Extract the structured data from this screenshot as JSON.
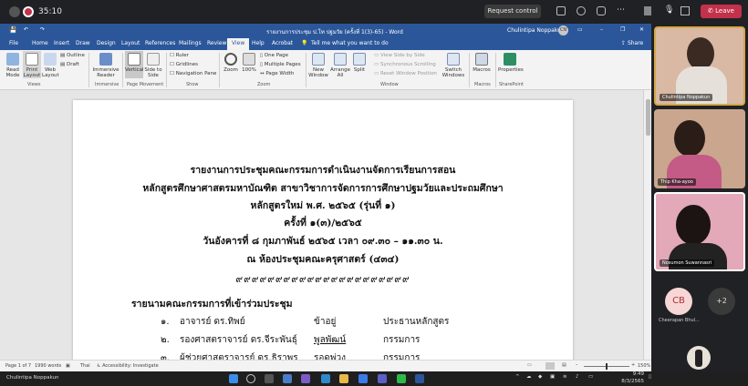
{
  "meeting": {
    "timer": "35:10",
    "request_control": "Request control",
    "leave": "Leave",
    "presenter_label": "Chulintipa Noppakun"
  },
  "word": {
    "title": "รายงานการประชุม ป.โท ปฐมวัย (ครั้งที่ 1(3)-65)  -  Word",
    "user": "Chulintipa Noppakun",
    "user_initials": "CN",
    "tell_me": "Tell me what you want to do",
    "share": "Share",
    "tabs": [
      "File",
      "Home",
      "Insert",
      "Draw",
      "Design",
      "Layout",
      "References",
      "Mailings",
      "Review",
      "View",
      "Help",
      "Acrobat"
    ],
    "active_tab": "View"
  },
  "ribbon": {
    "views": [
      "Read Mode",
      "Print Layout",
      "Web Layout"
    ],
    "immersive": "Immersive Reader",
    "page_movement": [
      "Vertical",
      "Side to Side"
    ],
    "show": [
      "Ruler",
      "Gridlines",
      "Navigation Pane"
    ],
    "outline": "Outline",
    "draft": "Draft",
    "zoom": [
      "Zoom",
      "100%"
    ],
    "zoom_opts": [
      "One Page",
      "Multiple Pages",
      "Page Width"
    ],
    "window": [
      "New Window",
      "Arrange All",
      "Split"
    ],
    "window_opts": [
      "View Side by Side",
      "Synchronous Scrolling",
      "Reset Window Position"
    ],
    "switch_windows": "Switch Windows",
    "macros": "Macros",
    "properties": "Properties",
    "groups": [
      "Views",
      "Immersive",
      "Page Movement",
      "Show",
      "Zoom",
      "Window",
      "Macros",
      "SharePoint"
    ]
  },
  "document": {
    "heading_lines": [
      "รายงานการประชุมคณะกรรมการดำเนินงานจัดการเรียนการสอน",
      "หลักสูตรศึกษาศาสตรมหาบัณฑิต สาขาวิชาการจัดการการศึกษาปฐมวัยและประถมศึกษา",
      "หลักสูตรใหม่ พ.ศ. ๒๕๖๕ (รุ่นที่ ๑)",
      "ครั้งที่ ๑(๓)/๒๕๖๕",
      "วันอังคารที่ ๘ กุมภาพันธ์ ๒๕๖๕ เวลา ๐๙.๓๐ – ๑๑.๓๐ น.",
      "ณ ห้องประชุมคณะครุศาสตร์ (๔๓๔)"
    ],
    "ornament": "๙๙๙๙๙๙๙๙๙๙๙๙๙๙๙๙๙๙๙๙๙๙",
    "attendees_heading": "รายนามคณะกรรมการที่เข้าร่วมประชุม",
    "attendees": [
      {
        "no": "๑.",
        "name": "อาจารย์ ดร.ทิพย์",
        "surname": "ข้าอยู่",
        "role": "ประธานหลักสูตร"
      },
      {
        "no": "๒.",
        "name": "รองศาสตราจารย์ ดร.จีระพันธุ์",
        "surname": "พูลพัฒน์",
        "role": "กรรมการ"
      },
      {
        "no": "๓.",
        "name": "ผู้ช่วยศาสตราจารย์ ดร.ธิราพร",
        "surname": "รอดพ่วง",
        "role": "กรรมการ"
      }
    ]
  },
  "status": {
    "page": "Page 1 of 7",
    "words": "1990 words",
    "lang": "Thai",
    "accessibility": "Accessibility: Investigate",
    "zoom": "150%"
  },
  "participants": [
    {
      "name": "Chulintipa Noppakun"
    },
    {
      "name": "Thip Kha-ayoo"
    },
    {
      "name": "Nosumon Suwannasri"
    }
  ],
  "avatar_cb": {
    "initials": "CB",
    "name": "Cheerapan Bhul..."
  },
  "more_count": "+2",
  "taskbar": {
    "time": "9:49",
    "date": "8/3/2565"
  },
  "colors": {
    "word_blue": "#2b579a",
    "leave_red": "#c4314b",
    "teams_bg": "#202124"
  }
}
